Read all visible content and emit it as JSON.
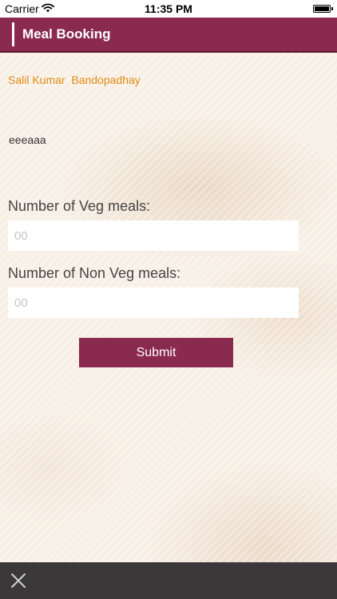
{
  "status_bar": {
    "carrier": "Carrier",
    "time": "11:35 PM"
  },
  "nav": {
    "title": "Meal Booking"
  },
  "user": {
    "name": "Salil Kumar  Bandopadhay"
  },
  "info": {
    "text": "eeeaaa"
  },
  "form": {
    "veg_label": "Number of Veg meals:",
    "veg_placeholder": "00",
    "veg_value": "",
    "nonveg_label": "Number of Non Veg meals:",
    "nonveg_placeholder": "00",
    "nonveg_value": "",
    "submit_label": "Submit"
  },
  "colors": {
    "brand": "#8a2a4e",
    "accent_text": "#e08a12",
    "bottom_bar": "#3a3838"
  },
  "icons": {
    "wifi": "wifi-icon",
    "battery": "battery-icon",
    "close": "close-icon"
  }
}
